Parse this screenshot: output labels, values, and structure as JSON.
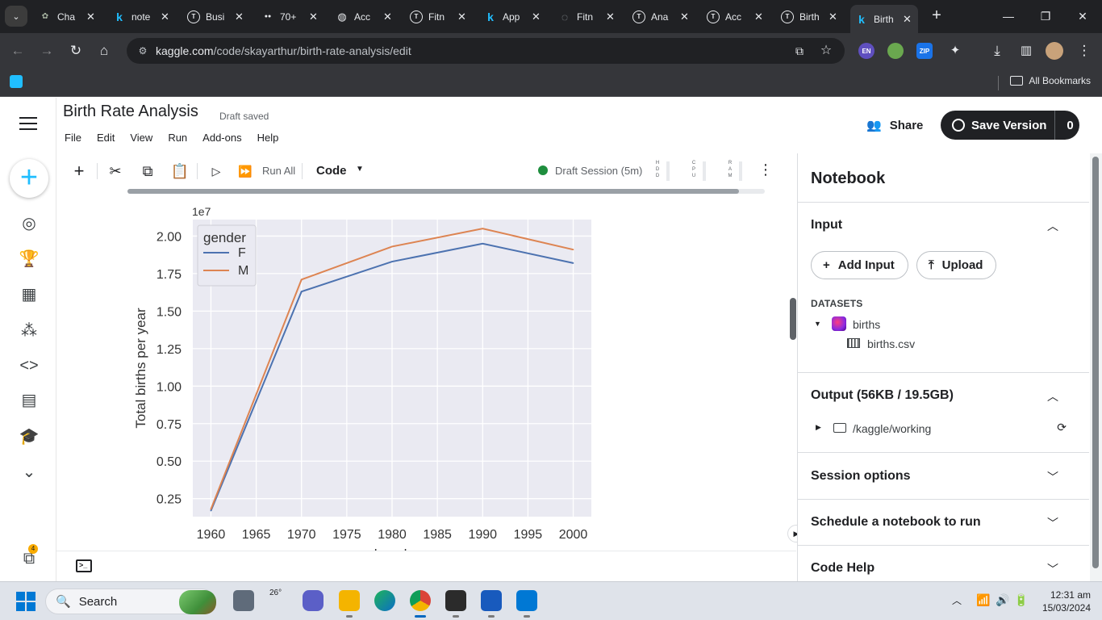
{
  "browser": {
    "tabs": [
      {
        "label": "Cha",
        "icon": "chatgpt-icon",
        "color": "#a8b5a2"
      },
      {
        "label": "note",
        "icon": "kaggle-icon",
        "color": "#20beff"
      },
      {
        "label": "Busi",
        "icon": "t-circle-icon",
        "color": "#e8eaed"
      },
      {
        "label": "70+",
        "icon": "tab-media-icon",
        "color": "#e8eaed"
      },
      {
        "label": "Acc",
        "icon": "globe-icon",
        "color": "#e8eaed"
      },
      {
        "label": "Fitn",
        "icon": "t-circle-icon",
        "color": "#e8eaed"
      },
      {
        "label": "App",
        "icon": "kaggle-icon",
        "color": "#20beff"
      },
      {
        "label": "Fitn",
        "icon": "loading-icon",
        "color": "#9aa0a6"
      },
      {
        "label": "Ana",
        "icon": "t-circle-icon",
        "color": "#e8eaed"
      },
      {
        "label": "Acc",
        "icon": "t-circle-icon",
        "color": "#e8eaed"
      },
      {
        "label": "Birth",
        "icon": "t-circle-icon",
        "color": "#e8eaed"
      },
      {
        "label": "Birth",
        "icon": "kaggle-icon",
        "color": "#20beff",
        "active": true
      }
    ],
    "url_domain": "kaggle.com",
    "url_path": "/code/skayarthur/birth-rate-analysis/edit",
    "bookmarks_all": "All Bookmarks",
    "extensions": [
      {
        "name": "en-extension-icon",
        "label": "EN",
        "color": "#5f4fbf"
      },
      {
        "name": "color-extension-icon",
        "label": "",
        "color": "#6aa84f"
      },
      {
        "name": "zip-extension-icon",
        "label": "ZIP",
        "color": "#1a73e8"
      }
    ]
  },
  "notebook": {
    "title": "Birth Rate Analysis",
    "status": "Draft saved",
    "menu": [
      "File",
      "Edit",
      "View",
      "Run",
      "Add-ons",
      "Help"
    ],
    "share_label": "Share",
    "save_version_label": "Save Version",
    "save_version_count": "0",
    "toolbar": {
      "run_all": "Run All",
      "cell_type": "Code",
      "session": "Draft Session (5m)",
      "meters": [
        "HDD",
        "CPU",
        "RAM"
      ]
    }
  },
  "rail": {
    "badge": "4"
  },
  "chart_data": {
    "type": "line",
    "x": [
      1960,
      1970,
      1980,
      1990,
      2000
    ],
    "series": [
      {
        "name": "F",
        "values": [
          0.17,
          1.63,
          1.83,
          1.95,
          1.82
        ],
        "color": "#4c72b0"
      },
      {
        "name": "M",
        "values": [
          0.18,
          1.71,
          1.93,
          2.05,
          1.91
        ],
        "color": "#dd8452"
      }
    ],
    "offset_label": "1e7",
    "xlabel": "decade",
    "ylabel": "Total births per year",
    "legend_title": "gender",
    "legend_position": "top-left",
    "xlim": [
      1958,
      2002
    ],
    "ylim": [
      0.13,
      2.11
    ],
    "xticks": [
      "1960",
      "1965",
      "1970",
      "1975",
      "1980",
      "1985",
      "1990",
      "1995",
      "2000"
    ],
    "yticks": [
      "0.25",
      "0.50",
      "0.75",
      "1.00",
      "1.25",
      "1.50",
      "1.75",
      "2.00"
    ],
    "grid": true,
    "background": "#eaeaf2"
  },
  "panel": {
    "title": "Notebook",
    "input_title": "Input",
    "add_input": "Add Input",
    "upload": "Upload",
    "datasets_label": "DATASETS",
    "dataset_name": "births",
    "dataset_file": "births.csv",
    "output_title": "Output (56KB / 19.5GB)",
    "output_path": "/kaggle/working",
    "session_options": "Session options",
    "schedule": "Schedule a notebook to run",
    "code_help": "Code Help"
  },
  "taskbar": {
    "search": "Search",
    "weather_temp": "26°",
    "time": "12:31 am",
    "date": "15/03/2024"
  }
}
